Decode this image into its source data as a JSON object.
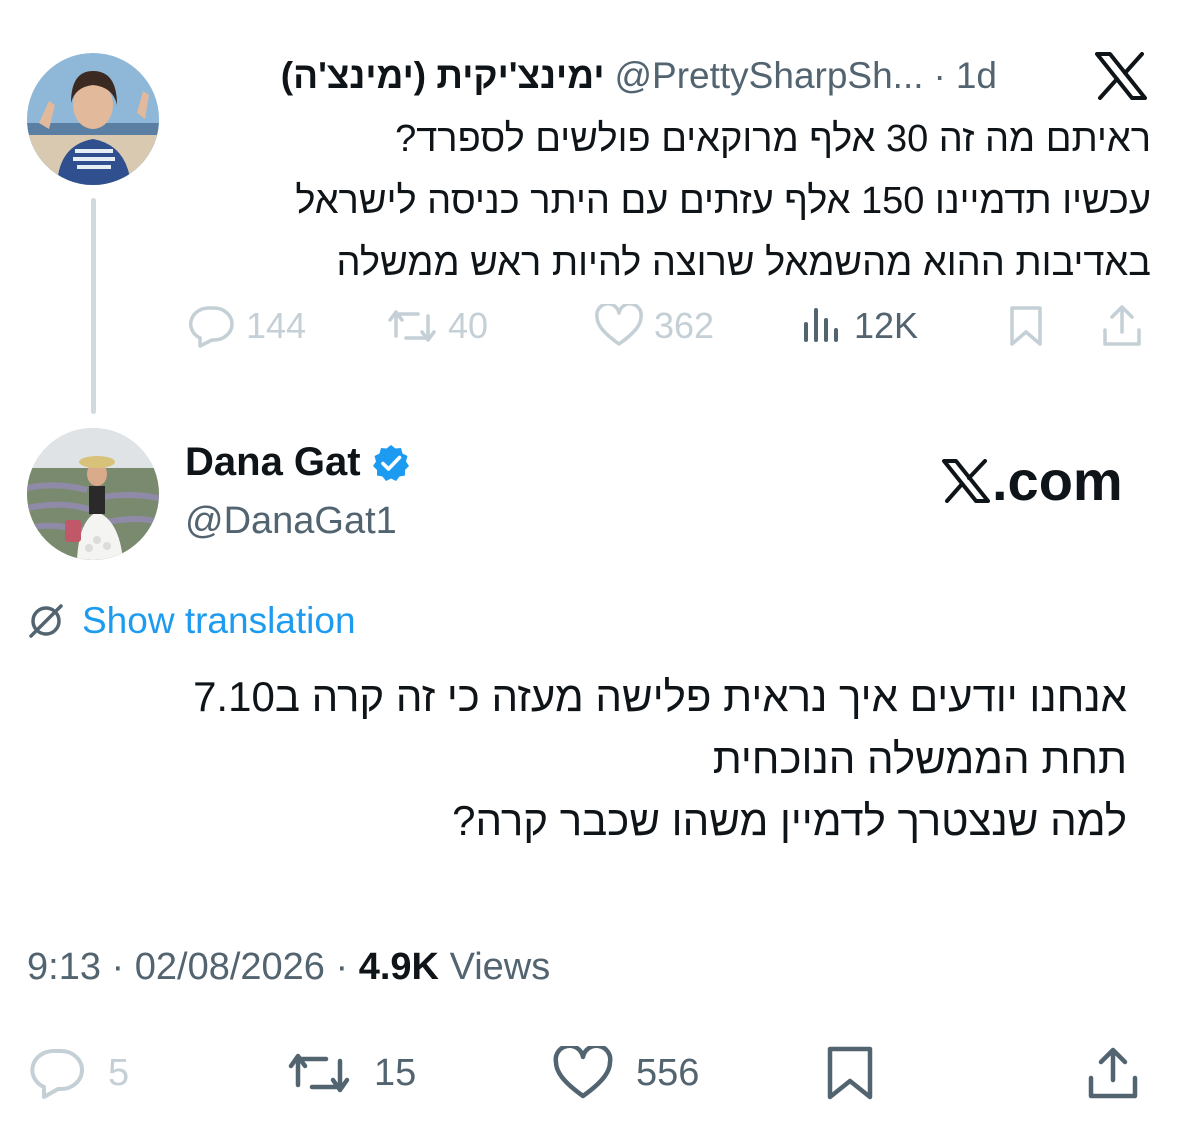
{
  "parent_tweet": {
    "display_name": "ימינצ'יקית (ימינצ'ה)",
    "handle": "@PrettySharpSh...",
    "separator": "·",
    "time": "1d",
    "text_lines": [
      "ראיתם מה זה 30 אלף מרוקאים פולשים לספרד?",
      "עכשיו תדמיינו 150 אלף עזתים עם היתר כניסה לישראל",
      "באדיבות ההוא מהשמאל שרוצה להיות ראש ממשלה"
    ],
    "actions": {
      "replies": "144",
      "reposts": "40",
      "likes": "362",
      "views": "12K"
    }
  },
  "main_tweet": {
    "display_name": "Dana Gat",
    "handle": "@DanaGat1",
    "site_badge": ".com",
    "translate_label": "Show translation",
    "text_lines": [
      "אנחנו יודעים איך נראית פלישה מעזה כי זה קרה ב7.10",
      "תחת הממשלה הנוכחית",
      "למה שנצטרך לדמיין משהו שכבר קרה?"
    ],
    "time": "9:13",
    "date": "02/08/2026",
    "separator": "·",
    "views_count": "4.9K",
    "views_label": "Views",
    "actions": {
      "replies": "5",
      "reposts": "15",
      "likes": "556"
    }
  },
  "colors": {
    "accent": "#1d9bf0",
    "text": "#0f1419",
    "secondary": "#536471",
    "faded": "#c4cfd6",
    "thread_line": "#cfd9de"
  },
  "icons": [
    "x-logo",
    "verified-badge",
    "translate-icon",
    "reply-icon",
    "repost-icon",
    "like-icon",
    "views-icon",
    "bookmark-icon",
    "share-icon"
  ]
}
